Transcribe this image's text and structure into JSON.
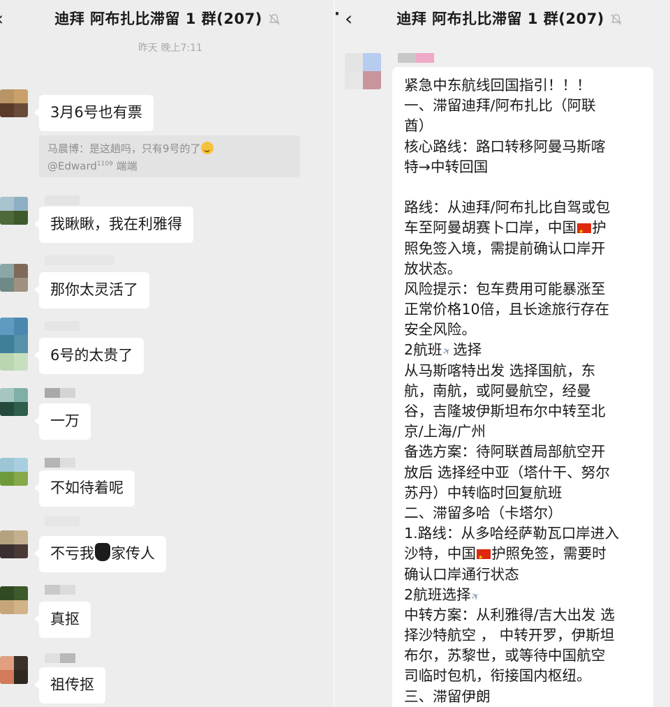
{
  "left": {
    "title": "迪拜 阿布扎比滞留 1 群(207)",
    "back_icon": "‹",
    "timestamp": "昨天 晚上7:11",
    "quote": {
      "line1_prefix": "马晨博：是这趟吗，只有9号的了",
      "line2_mention": "@Edward",
      "line2_sup": "1109",
      "line2_suffix": " 端端"
    },
    "messages": [
      {
        "text": "3月6号也有票"
      },
      {
        "text": "我瞅瞅，我在利雅得"
      },
      {
        "text": "那你太灵活了"
      },
      {
        "text": "6号的太贵了"
      },
      {
        "text": "一万"
      },
      {
        "text": "不如待着呢"
      },
      {
        "text_before": "不亏我",
        "text_after": "家传人"
      },
      {
        "text": "真抠"
      },
      {
        "text": "祖传抠"
      }
    ]
  },
  "right": {
    "more_icon": "···",
    "back_icon": "‹",
    "title": "迪拜 阿布扎比滞留 1 群(207)",
    "message_lines": [
      "紧急中东航线回国指引！！！",
      "一、滞留迪拜/阿布扎比（阿联",
      "酋）",
      "核心路线：路口转移阿曼马斯喀",
      "特→中转回国",
      "",
      "路线：从迪拜/阿布扎比自驾或包",
      "车至阿曼胡赛卜口岸，中国",
      "照免签入境，需提前确认口岸开",
      "放状态。",
      "风险提示：包车费用可能暴涨至",
      "正常价格10倍，且长途旅行存在",
      "安全风险。",
      "2航班",
      "从马斯喀特出发 选择国航，东",
      "航，南航，或阿曼航空，经曼",
      "谷，吉隆坡伊斯坦布尔中转至北",
      "京/上海/广州",
      "备选方案：待阿联酋局部航空开",
      "放后 选择经中亚（塔什干、努尔",
      "苏丹）中转临时回复航班",
      "二、滞留多哈（卡塔尔）",
      "1.路线：从多哈经萨勒瓦口岸进入",
      "沙特，中国",
      "确认口岸通行状态",
      "2航班选择",
      "中转方案：从利雅得/吉大出发 选",
      "择沙特航空  ，  中转开罗，伊斯坦",
      "布尔，苏黎世，或等待中国航空",
      "司临时包机，衔接国内枢纽。",
      "三、滞留伊朗"
    ],
    "inline_tails": {
      "flag_line_1_after": "护",
      "flight_line_after": "选择",
      "flag_line_2_after": "护照免签，需要时"
    }
  },
  "colors": {
    "background": "#ededed",
    "bubble": "#ffffff",
    "flag_red": "#de2910"
  }
}
